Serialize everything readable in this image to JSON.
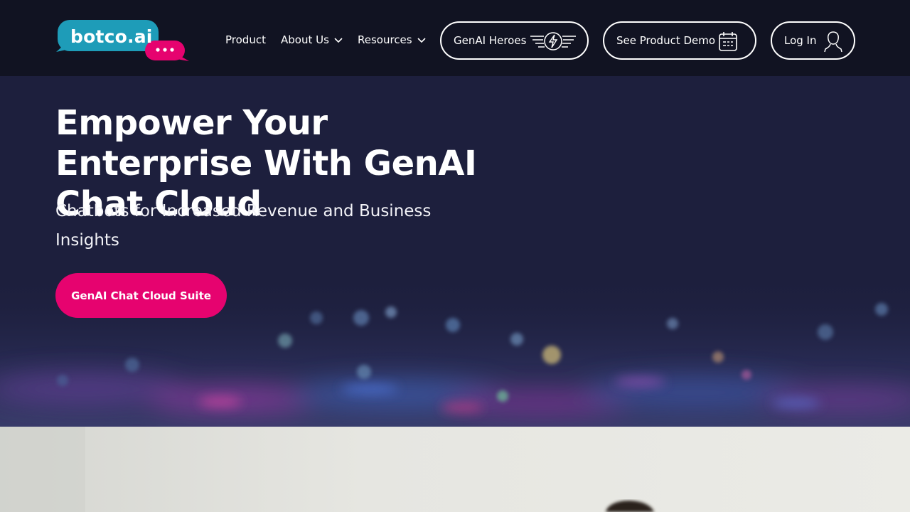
{
  "brand": {
    "logo_text": "botco.ai",
    "logo_icon": "speech-bubbles-logo",
    "colors": {
      "teal": "#1e9cb8",
      "pink": "#e6036f",
      "nav_bg": "#111322",
      "hero_bg": "#1d1f3d"
    }
  },
  "nav": {
    "product": "Product",
    "about": "About Us",
    "resources": "Resources",
    "heroes": "GenAI Heroes",
    "heroes_icon": "winged-lightning-icon",
    "demo": "See Product Demo",
    "demo_icon": "calendar-icon",
    "login": "Log In",
    "login_icon": "user-icon"
  },
  "hero": {
    "title": "Empower Your Enterprise With GenAI Chat Cloud",
    "subtitle": "Chatbots for Increased Revenue and Business Insights",
    "cta": "GenAI Chat Cloud Suite"
  }
}
